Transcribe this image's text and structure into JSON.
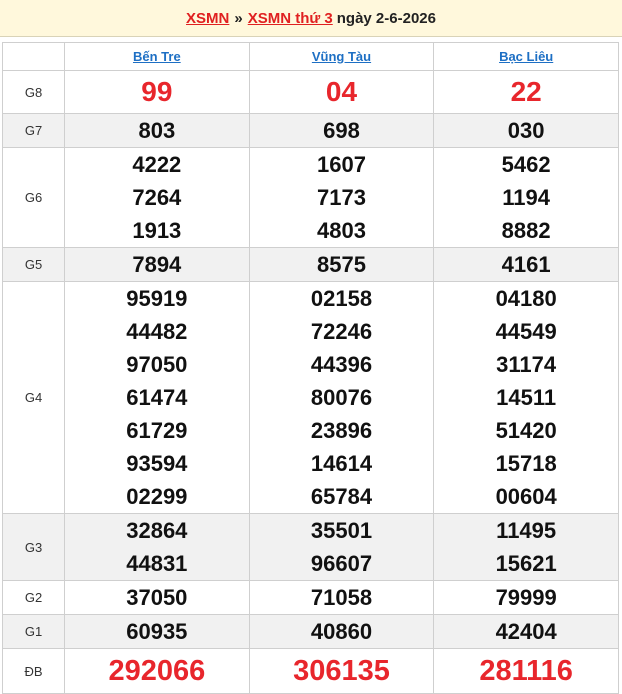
{
  "header": {
    "link1": "XSMN",
    "separator": "»",
    "link2": "XSMN thứ 3",
    "date_text": "ngày 2-6-2026"
  },
  "provinces": [
    "Bến Tre",
    "Vũng Tàu",
    "Bạc Liêu"
  ],
  "prizes": [
    {
      "label": "G8",
      "values": [
        [
          "99"
        ],
        [
          "04"
        ],
        [
          "22"
        ]
      ]
    },
    {
      "label": "G7",
      "values": [
        [
          "803"
        ],
        [
          "698"
        ],
        [
          "030"
        ]
      ]
    },
    {
      "label": "G6",
      "values": [
        [
          "4222",
          "7264",
          "1913"
        ],
        [
          "1607",
          "7173",
          "4803"
        ],
        [
          "5462",
          "1194",
          "8882"
        ]
      ]
    },
    {
      "label": "G5",
      "values": [
        [
          "7894"
        ],
        [
          "8575"
        ],
        [
          "4161"
        ]
      ]
    },
    {
      "label": "G4",
      "values": [
        [
          "95919",
          "44482",
          "97050",
          "61474",
          "61729",
          "93594",
          "02299"
        ],
        [
          "02158",
          "72246",
          "44396",
          "80076",
          "23896",
          "14614",
          "65784"
        ],
        [
          "04180",
          "44549",
          "31174",
          "14511",
          "51420",
          "15718",
          "00604"
        ]
      ]
    },
    {
      "label": "G3",
      "values": [
        [
          "32864",
          "44831"
        ],
        [
          "35501",
          "96607"
        ],
        [
          "11495",
          "15621"
        ]
      ]
    },
    {
      "label": "G2",
      "values": [
        [
          "37050"
        ],
        [
          "71058"
        ],
        [
          "79999"
        ]
      ]
    },
    {
      "label": "G1",
      "values": [
        [
          "60935"
        ],
        [
          "40860"
        ],
        [
          "42404"
        ]
      ]
    },
    {
      "label": "ĐB",
      "values": [
        [
          "292066"
        ],
        [
          "306135"
        ],
        [
          "281116"
        ]
      ]
    }
  ],
  "colors": {
    "accent_red": "#e8262c",
    "link_blue": "#1d6fc4",
    "header_bg": "#fff8dc"
  }
}
